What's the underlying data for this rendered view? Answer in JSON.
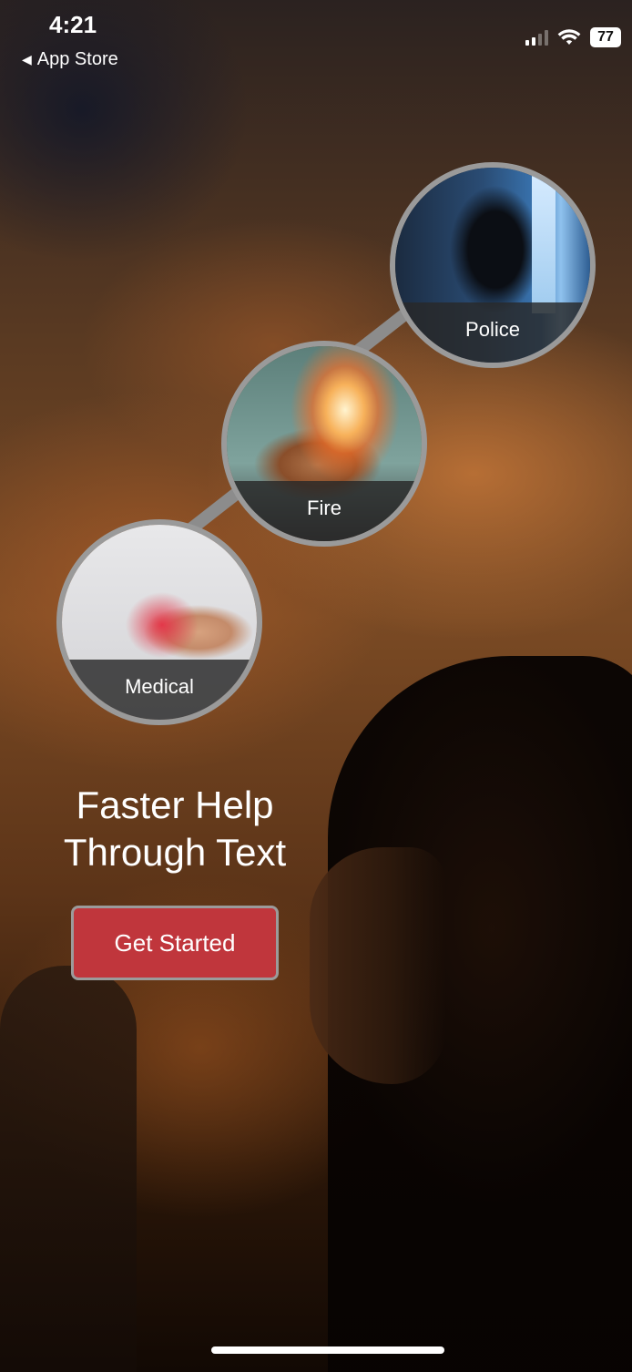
{
  "status_bar": {
    "time": "4:21",
    "back_label": "App Store",
    "battery": "77",
    "icons": [
      "signal-icon",
      "wifi-icon",
      "battery-icon"
    ]
  },
  "services": [
    {
      "label": "Police",
      "icon": "police-image"
    },
    {
      "label": "Fire",
      "icon": "fire-image"
    },
    {
      "label": "Medical",
      "icon": "medical-image"
    }
  ],
  "headline": {
    "line1": "Faster Help",
    "line2": "Through Text"
  },
  "cta": {
    "label": "Get Started",
    "color": "#c0363c"
  }
}
